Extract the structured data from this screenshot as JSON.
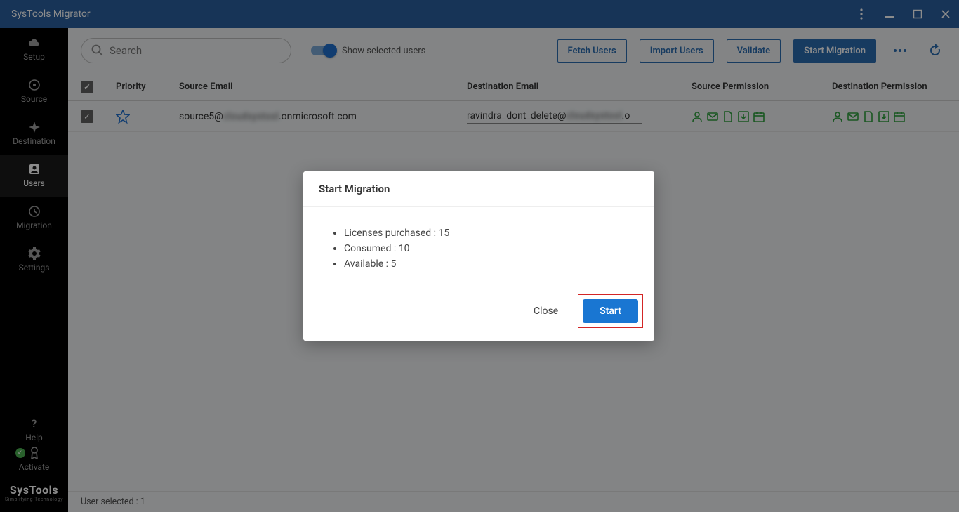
{
  "titlebar": {
    "title": "SysTools Migrator"
  },
  "sidebar": {
    "items": [
      {
        "label": "Setup"
      },
      {
        "label": "Source"
      },
      {
        "label": "Destination"
      },
      {
        "label": "Users"
      },
      {
        "label": "Migration"
      },
      {
        "label": "Settings"
      }
    ],
    "help": "Help",
    "activate": "Activate",
    "logo": "SysTools",
    "logo_sub": "Simplifying Technology"
  },
  "toolbar": {
    "search_placeholder": "Search",
    "toggle_label": "Show selected users",
    "fetch": "Fetch Users",
    "import": "Import Users",
    "validate": "Validate",
    "start": "Start Migration"
  },
  "columns": {
    "priority": "Priority",
    "source_email": "Source Email",
    "dest_email": "Destination Email",
    "source_perm": "Source Permission",
    "dest_perm": "Destination Permission"
  },
  "rows": [
    {
      "source_prefix": "source5@",
      "source_blurred": "cloudsystool",
      "source_suffix": ".onmicrosoft.com",
      "dest_prefix": "ravindra_dont_delete@",
      "dest_blurred": "cloudsystool",
      "dest_suffix": ".o"
    }
  ],
  "status": {
    "selected": "User selected : 1"
  },
  "modal": {
    "title": "Start Migration",
    "license_line": "Licenses purchased : 15",
    "consumed_line": "Consumed : 10",
    "available_line": "Available : 5",
    "close": "Close",
    "start": "Start"
  }
}
